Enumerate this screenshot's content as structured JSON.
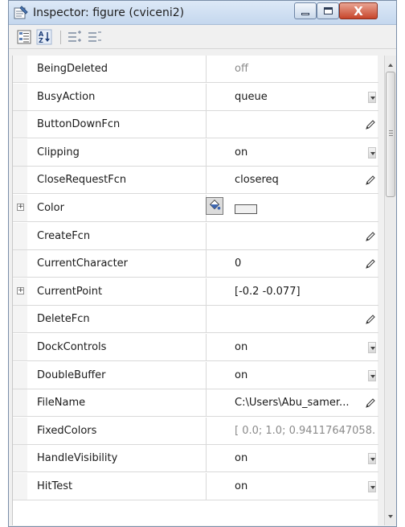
{
  "window": {
    "title": "Inspector:  figure (cviceni2)",
    "controls": {
      "minimize": "minimize",
      "maximize": "maximize",
      "close": "X"
    }
  },
  "toolbar": {
    "icons": [
      "categorized-view-icon",
      "sort-alphabetical-icon",
      "expand-all-icon",
      "collapse-all-icon"
    ]
  },
  "properties": [
    {
      "name": "BeingDeleted",
      "value": "off",
      "editor": "none",
      "muted": true,
      "expandable": false
    },
    {
      "name": "BusyAction",
      "value": "queue",
      "editor": "dropdown",
      "muted": false,
      "expandable": false
    },
    {
      "name": "ButtonDownFcn",
      "value": "",
      "editor": "pencil",
      "muted": false,
      "expandable": false
    },
    {
      "name": "Clipping",
      "value": "on",
      "editor": "dropdown",
      "muted": false,
      "expandable": false
    },
    {
      "name": "CloseRequestFcn",
      "value": "closereq",
      "editor": "pencil",
      "muted": false,
      "expandable": false
    },
    {
      "name": "Color",
      "value": "",
      "editor": "color",
      "muted": false,
      "expandable": true
    },
    {
      "name": "CreateFcn",
      "value": "",
      "editor": "pencil",
      "muted": false,
      "expandable": false
    },
    {
      "name": "CurrentCharacter",
      "value": "0",
      "editor": "pencil",
      "muted": false,
      "expandable": false
    },
    {
      "name": "CurrentPoint",
      "value": "[-0.2 -0.077]",
      "editor": "none",
      "muted": false,
      "expandable": true
    },
    {
      "name": "DeleteFcn",
      "value": "",
      "editor": "pencil",
      "muted": false,
      "expandable": false
    },
    {
      "name": "DockControls",
      "value": "on",
      "editor": "dropdown",
      "muted": false,
      "expandable": false
    },
    {
      "name": "DoubleBuffer",
      "value": "on",
      "editor": "dropdown",
      "muted": false,
      "expandable": false
    },
    {
      "name": "FileName",
      "value": "C:\\Users\\Abu_samer...",
      "editor": "pencil",
      "muted": false,
      "expandable": false
    },
    {
      "name": "FixedColors",
      "value": "[ 0.0; 1.0; 0.94117647058...",
      "editor": "none",
      "muted": true,
      "expandable": false
    },
    {
      "name": "HandleVisibility",
      "value": "on",
      "editor": "dropdown",
      "muted": false,
      "expandable": false
    },
    {
      "name": "HitTest",
      "value": "on",
      "editor": "dropdown",
      "muted": false,
      "expandable": false
    }
  ],
  "colors": {
    "titlebar": "#c4d7ee",
    "close_button": "#c7452b",
    "grid_lines": "#d9d9d9",
    "muted_text": "#8a8a8a"
  }
}
